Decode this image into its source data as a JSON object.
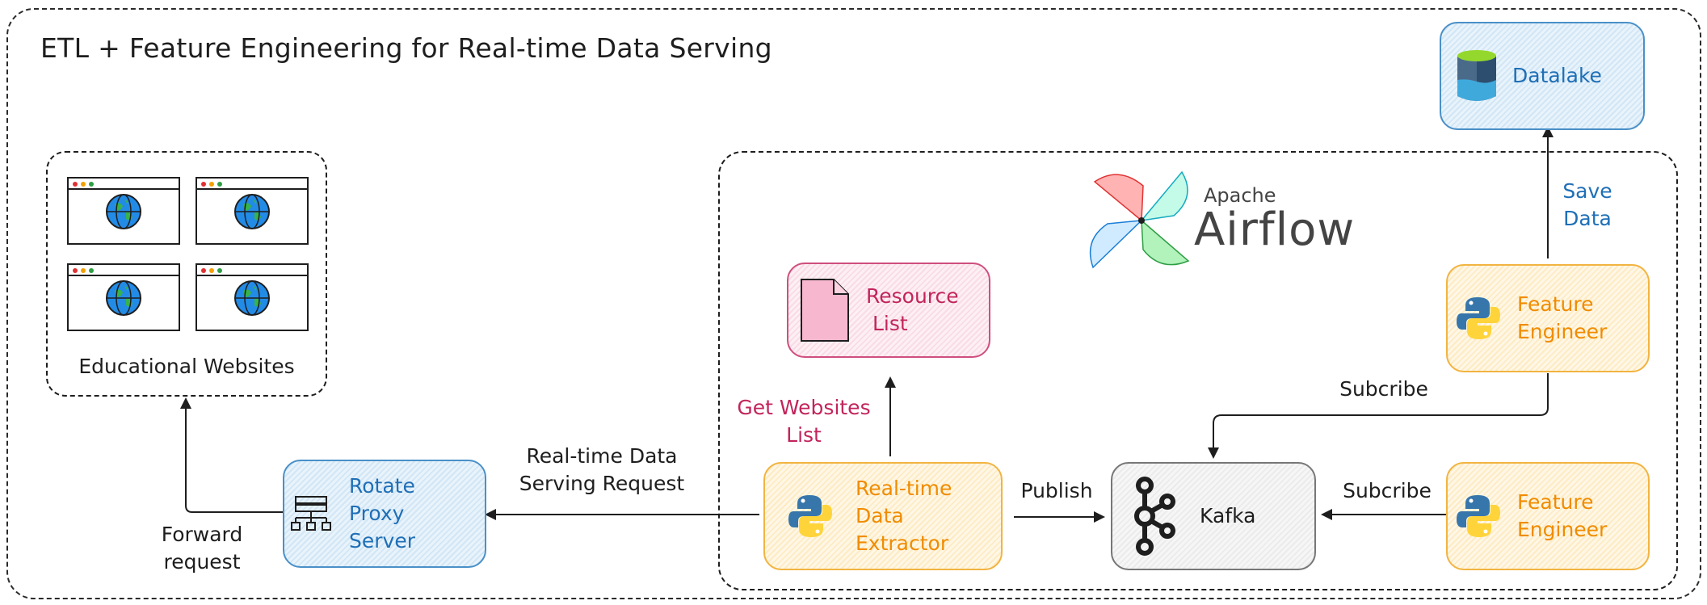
{
  "title": "ETL + Feature Engineering for Real-time Data Serving",
  "websites": {
    "label": "Educational Websites",
    "count": 4
  },
  "airflow": {
    "apache": "Apache",
    "name": "Airflow"
  },
  "nodes": {
    "datalake": "Datalake",
    "resource_list": {
      "line1": "Resource",
      "line2": "List"
    },
    "rotate_proxy": {
      "line1": "Rotate",
      "line2": "Proxy",
      "line3": "Server"
    },
    "extractor": {
      "line1": "Real-time",
      "line2": "Data",
      "line3": "Extractor"
    },
    "kafka": "Kafka",
    "feature_engineer_top": {
      "line1": "Feature",
      "line2": "Engineer"
    },
    "feature_engineer_bottom": {
      "line1": "Feature",
      "line2": "Engineer"
    }
  },
  "edges": {
    "save_data": {
      "line1": "Save",
      "line2": "Data"
    },
    "get_websites": {
      "line1": "Get Websites",
      "line2": "List"
    },
    "serving_request": {
      "line1": "Real-time Data",
      "line2": "Serving Request"
    },
    "publish": "Publish",
    "subscribe_top": "Subcribe",
    "subscribe_bottom": "Subcribe",
    "forward_request": {
      "line1": "Forward",
      "line2": "request"
    }
  },
  "colors": {
    "blue": "#1f6fb6",
    "orange": "#f08c00",
    "pink": "#c2255c",
    "stroke": "#1e1e1e"
  }
}
